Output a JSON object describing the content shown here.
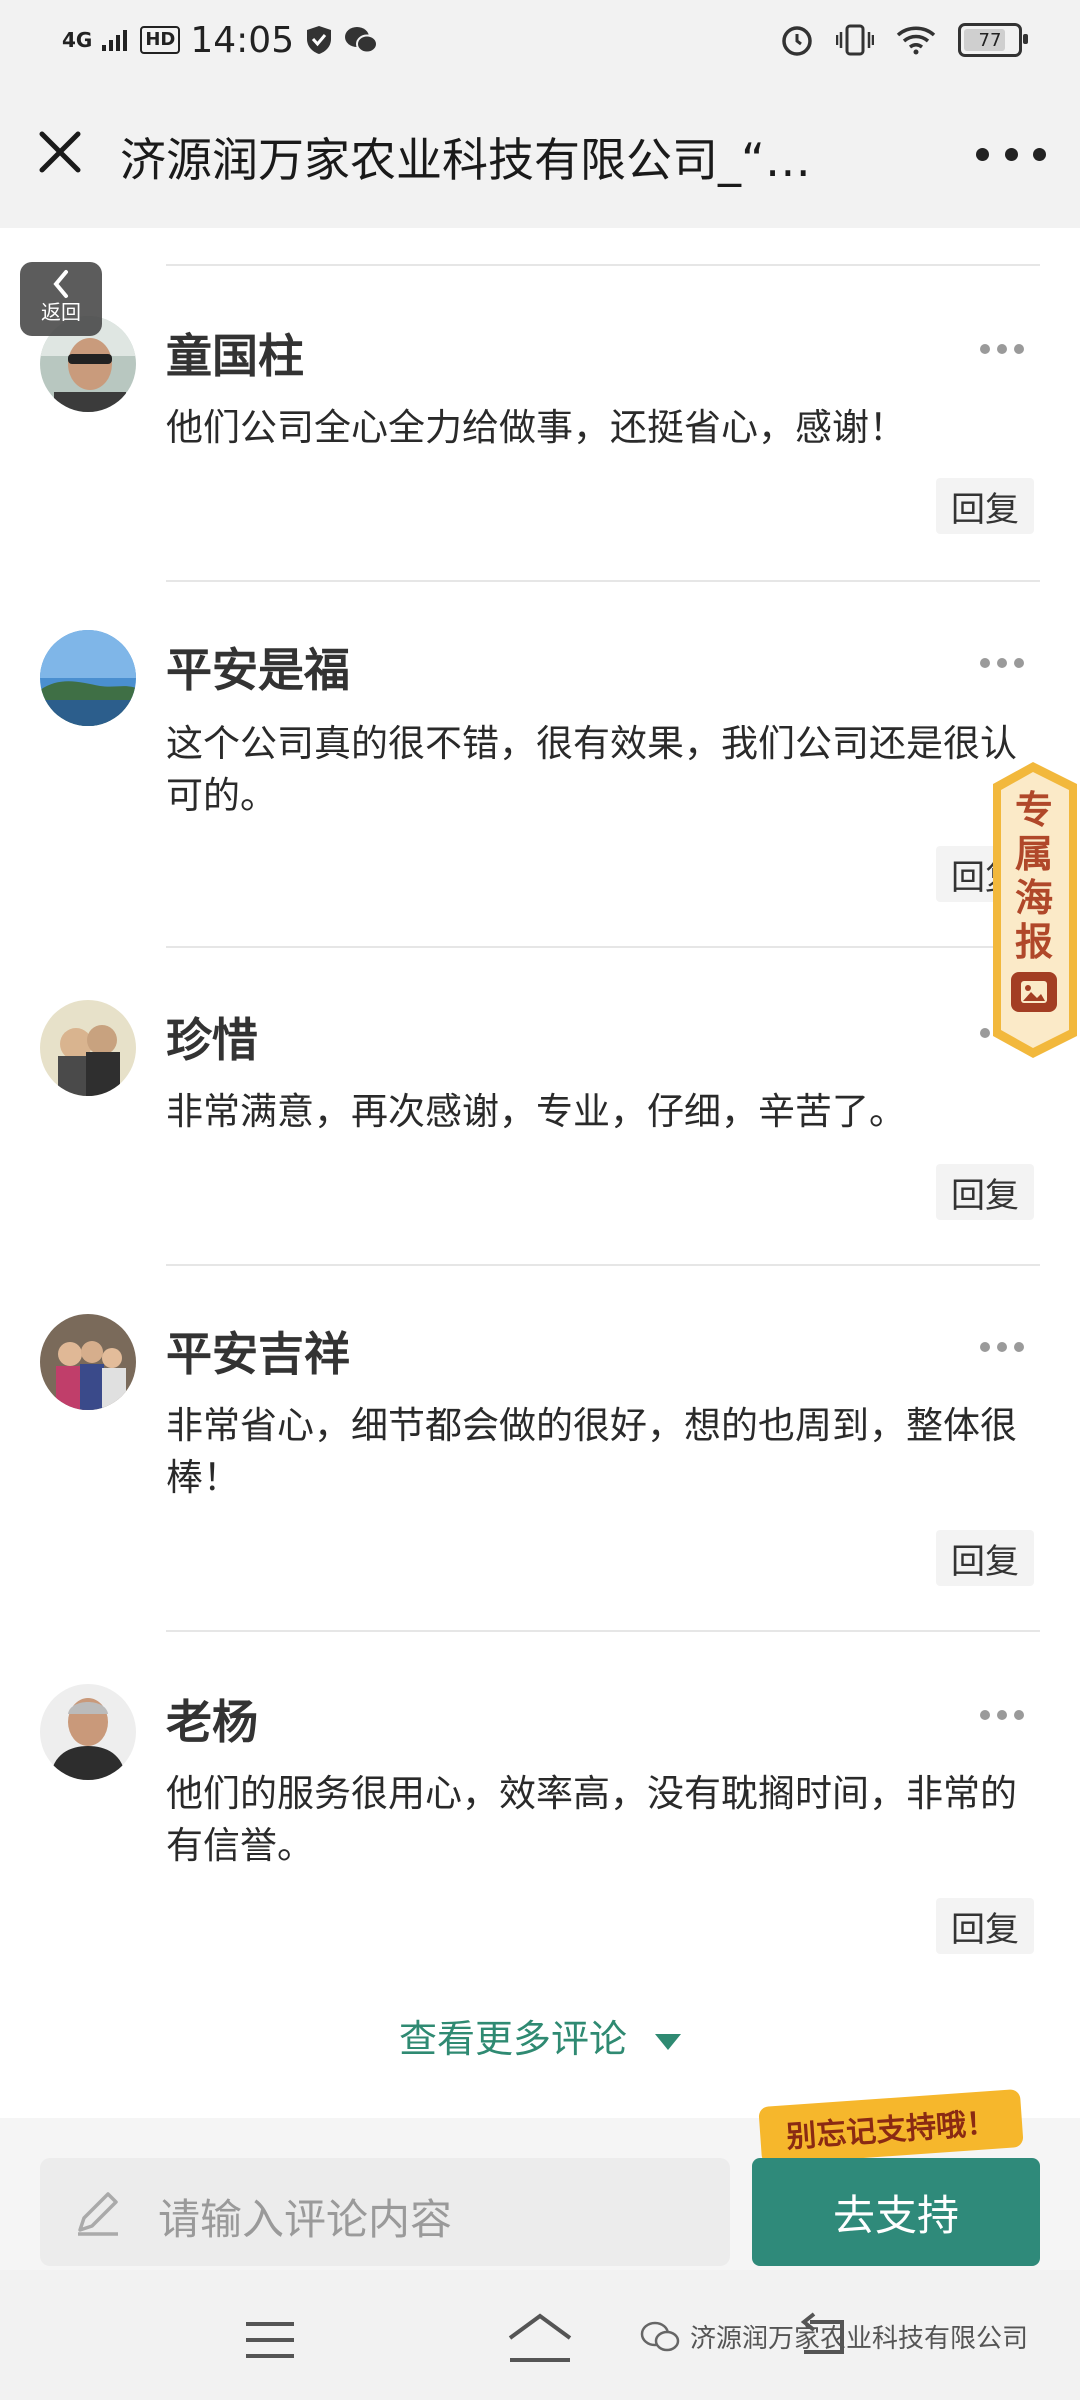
{
  "status_bar": {
    "signal": "4G",
    "hd": "HD",
    "time": "14:05",
    "battery": "77"
  },
  "nav": {
    "title": "济源润万家农业科技有限公司_“…"
  },
  "back_float": {
    "label": "返回"
  },
  "poster": {
    "label": "专属海报"
  },
  "comments": [
    {
      "name": "童国柱",
      "text": "他们公司全心全力给做事，还挺省心，感谢！",
      "reply": "回复"
    },
    {
      "name": "平安是福",
      "text": "这个公司真的很不错，很有效果，我们公司还是很认可的。",
      "reply": "回复"
    },
    {
      "name": "珍惜",
      "text": "非常满意，再次感谢，专业，仔细，辛苦了。",
      "reply": "回复"
    },
    {
      "name": "平安吉祥",
      "text": "非常省心，细节都会做的很好，想的也周到，整体很棒！",
      "reply": "回复"
    },
    {
      "name": "老杨",
      "text": "他们的服务很用心，效率高，没有耽搁时间，非常的有信誉。",
      "reply": "回复"
    }
  ],
  "more_comments": "查看更多评论",
  "input": {
    "placeholder": "请输入评论内容",
    "support_button": "去支持",
    "remind_badge": "别忘记支持哦！"
  },
  "watermark": "济源润万家农业科技有限公司"
}
